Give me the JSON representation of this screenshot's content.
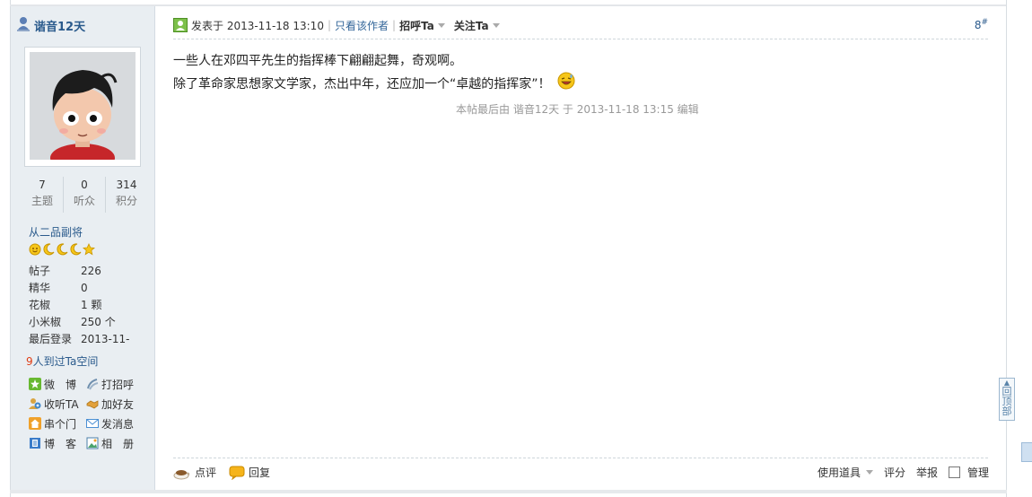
{
  "author": {
    "name": "谐音12天",
    "stats": [
      {
        "value": "7",
        "label": "主题"
      },
      {
        "value": "0",
        "label": "听众"
      },
      {
        "value": "314",
        "label": "积分"
      }
    ],
    "rank_title": "从二品副将",
    "info": [
      {
        "label": "帖子",
        "value": "226"
      },
      {
        "label": "精华",
        "value": "0"
      },
      {
        "label": "花椒",
        "value": "1 颗"
      },
      {
        "label": "小米椒",
        "value": "250 个"
      },
      {
        "label": "最后登录",
        "value": "2013-11-"
      }
    ],
    "visitors": {
      "count": "9",
      "text": "人到过Ta空间"
    },
    "links": [
      {
        "label": "微　博",
        "icon": "weibo-icon",
        "color": "#67b830"
      },
      {
        "label": "打招呼",
        "icon": "wave-icon",
        "color": "#6f8fae"
      },
      {
        "label": "收听TA",
        "icon": "follow-icon",
        "color": "#d9a441"
      },
      {
        "label": "加好友",
        "icon": "handshake-icon",
        "color": "#e2a13b"
      },
      {
        "label": "串个门",
        "icon": "home-icon",
        "color": "#f0a12a"
      },
      {
        "label": "发消息",
        "icon": "mail-icon",
        "color": "#4a8fd3"
      },
      {
        "label": "博　客",
        "icon": "blog-icon",
        "color": "#3a7cc9"
      },
      {
        "label": "相　册",
        "icon": "album-icon",
        "color": "#4aa36c"
      }
    ]
  },
  "post": {
    "posted_at": "发表于 2013-11-18 13:10",
    "only_author": "只看该作者",
    "greet": "招呼Ta",
    "follow": "关注Ta",
    "floor": "8",
    "floor_sup": "#",
    "lines": [
      "一些人在邓四平先生的指挥棒下翩翩起舞，奇观啊。",
      "除了革命家思想家文学家，杰出中年，还应加一个“卓越的指挥家”！"
    ],
    "edit_note": "本帖最后由 谐音12天 于 2013-11-18 13:15 编辑"
  },
  "footer": {
    "comment": "点评",
    "reply": "回复",
    "tools": "使用道具",
    "rate": "评分",
    "report": "举报",
    "manage": "管理"
  },
  "back_to_top": [
    "回",
    "顶",
    "部"
  ]
}
